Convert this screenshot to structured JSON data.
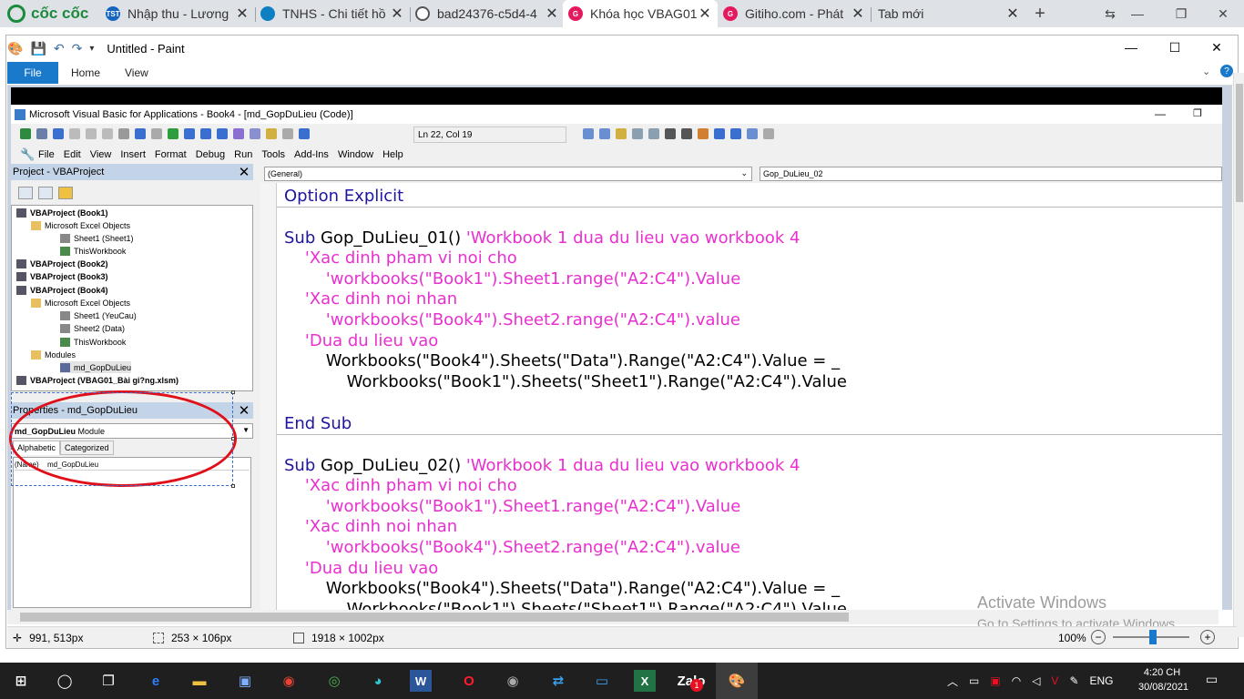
{
  "browser": {
    "brand": "cốc cốc",
    "tabs": [
      {
        "title": "Nhập thu - Lương",
        "icon": "tst-icon",
        "color": "#1565c0",
        "glyph": "TST"
      },
      {
        "title": "TNHS - Chi tiết hồ",
        "icon": "tnhs-icon",
        "color": "#0d7fc2",
        "glyph": ""
      },
      {
        "title": "bad24376-c5d4-4",
        "icon": "globe-icon",
        "color": "#555555",
        "glyph": ""
      },
      {
        "title": "Khóa học VBAG01",
        "icon": "gitiho-icon",
        "color": "#e5195e",
        "glyph": "G"
      },
      {
        "title": "Gitiho.com - Phát",
        "icon": "gitiho-icon",
        "color": "#e5195e",
        "glyph": "G"
      },
      {
        "title": "Tab mới",
        "icon": "",
        "color": "",
        "glyph": ""
      }
    ],
    "new_tab": "+"
  },
  "paint": {
    "title": "Untitled - Paint",
    "file_tab": "File",
    "tabs": [
      "Home",
      "View"
    ],
    "status": {
      "cursor_pos": "991, 513px",
      "selection_size": "253 × 106px",
      "image_size": "1918 × 1002px",
      "zoom": "100%"
    }
  },
  "vba": {
    "title": "Microsoft Visual Basic for Applications - Book4 - [md_GopDuLieu (Code)]",
    "position": "Ln 22, Col 19",
    "menu": [
      "File",
      "Edit",
      "View",
      "Insert",
      "Format",
      "Debug",
      "Run",
      "Tools",
      "Add-Ins",
      "Window",
      "Help"
    ],
    "project": {
      "header": "Project - VBAProject",
      "tree": [
        {
          "label": "VBAProject (Book1)",
          "bold": true
        },
        {
          "label": "Microsoft Excel Objects",
          "bold": false
        },
        {
          "label": "Sheet1 (Sheet1)",
          "bold": false
        },
        {
          "label": "ThisWorkbook",
          "bold": false
        },
        {
          "label": "VBAProject (Book2)",
          "bold": true
        },
        {
          "label": "VBAProject (Book3)",
          "bold": true
        },
        {
          "label": "VBAProject (Book4)",
          "bold": true
        },
        {
          "label": "Microsoft Excel Objects",
          "bold": false
        },
        {
          "label": "Sheet1 (YeuCau)",
          "bold": false
        },
        {
          "label": "Sheet2 (Data)",
          "bold": false
        },
        {
          "label": "ThisWorkbook",
          "bold": false
        },
        {
          "label": "Modules",
          "bold": false
        },
        {
          "label": "md_GopDuLieu",
          "bold": false
        },
        {
          "label": "VBAProject (VBAG01_Bài gi?ng.xlsm)",
          "bold": true
        }
      ]
    },
    "properties": {
      "header": "Properties - md_GopDuLieu",
      "object": "md_GopDuLieu",
      "object_type": "Module",
      "tabs": [
        "Alphabetic",
        "Categorized"
      ],
      "row_name": "(Name)",
      "row_value": "md_GopDuLieu"
    },
    "code": {
      "general": "(General)",
      "procedure": "Gop_DuLieu_02",
      "line1": "Option Explicit",
      "sub1_kw": "Sub ",
      "sub1_name": "Gop_DuLieu_01() ",
      "sub1_cm": "'Workbook 1 dua du lieu vao workbook 4",
      "c1": "    'Xac dinh pham vi noi cho",
      "c2": "        'workbooks(\"Book1\").Sheet1.range(\"A2:C4\").Value",
      "c3": "    'Xac dinh noi nhan",
      "c4": "        'workbooks(\"Book4\").Sheet2.range(\"A2:C4\").value",
      "c5": "    'Dua du lieu vao",
      "s1": "        Workbooks(\"Book4\").Sheets(\"Data\").Range(\"A2:C4\").Value = _",
      "s2": "            Workbooks(\"Book1\").Sheets(\"Sheet1\").Range(\"A2:C4\").Value",
      "endsub": "End Sub",
      "sub2_kw": "Sub ",
      "sub2_name": "Gop_DuLieu_02() ",
      "sub2_cm": "'Workbook 1 dua du lieu vao workbook 4",
      "d1": "    'Xac dinh pham vi noi cho",
      "d2": "        'workbooks(\"Book1\").Sheet1.range(\"A2:C4\").Value",
      "d3": "    'Xac dinh noi nhan",
      "d4": "        'workbooks(\"Book4\").Sheet2.range(\"A2:C4\").value",
      "d5": "    'Dua du lieu vao",
      "t1": "        Workbooks(\"Book4\").Sheets(\"Data\").Range(\"A2:C4\").Value = _",
      "t2": "            Workbooks(\"Book1\").Sheets(\"Sheet1\").Range(\"A2:C4\").Value"
    }
  },
  "watermark": {
    "line1": "Activate Windows",
    "line2": "Go to Settings to activate Windows."
  },
  "taskbar": {
    "lang": "ENG",
    "time": "4:20 CH",
    "date": "30/08/2021",
    "zalo_badge": "1"
  },
  "colors": {
    "keyword": "#1f16a0",
    "comment": "#ea2fd0",
    "paint_accent": "#1979ca",
    "annotation": "#e0101a"
  }
}
